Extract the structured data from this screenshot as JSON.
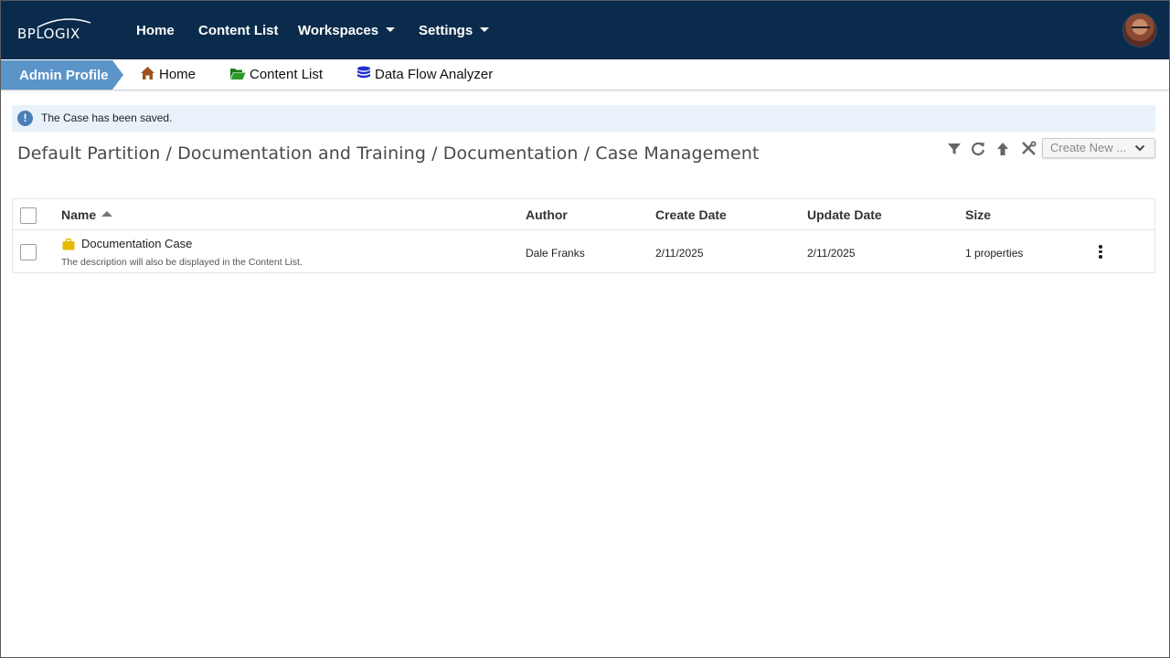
{
  "brand": {
    "logo_text": "BPLOGIX"
  },
  "top_nav": {
    "items": [
      {
        "label": "Home"
      },
      {
        "label": "Content List"
      },
      {
        "label": "Workspaces"
      },
      {
        "label": "Settings"
      }
    ]
  },
  "breadcrumbs": {
    "profile": "Admin Profile",
    "items": [
      {
        "label": "Home",
        "icon": "home-icon",
        "color": "#a0521d"
      },
      {
        "label": "Content List",
        "icon": "folder-open-icon",
        "color": "#1f7a1f"
      },
      {
        "label": "Data Flow Analyzer",
        "icon": "database-icon",
        "color": "#1f2fd0"
      }
    ]
  },
  "alert": {
    "text": "The Case has been saved.",
    "icon": "info-exclamation-icon"
  },
  "path_title": "Default Partition / Documentation and Training / Documentation / Case Management",
  "toolbar": {
    "icons": [
      "filter-icon",
      "refresh-icon",
      "up-arrow-icon",
      "tools-icon"
    ],
    "create_new_label": "Create New ..."
  },
  "table": {
    "columns": [
      "Name",
      "Author",
      "Create Date",
      "Update Date",
      "Size"
    ],
    "sort_column": "Name",
    "rows": [
      {
        "name": "Documentation Case",
        "description": "The description will also be displayed in the Content List.",
        "author": "Dale Franks",
        "create_date": "2/11/2025",
        "update_date": "2/11/2025",
        "size": "1 properties"
      }
    ]
  },
  "colors": {
    "topbar": "#0a2b4b",
    "admin_tab": "#5b94c9",
    "alert_bg": "#e9f1fb",
    "case_icon": "#e6b800"
  }
}
